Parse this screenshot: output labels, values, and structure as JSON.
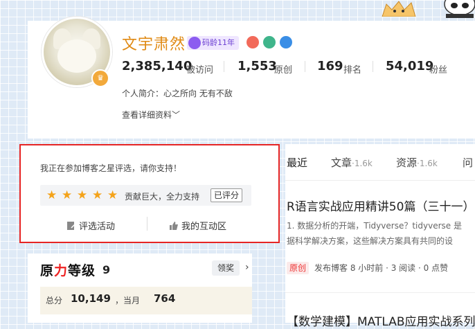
{
  "profile": {
    "username": "文宇肃然",
    "code_age": "码龄11年",
    "stats": [
      {
        "value": "2,385,140",
        "label": "被访问"
      },
      {
        "value": "1,553",
        "label": "原创"
      },
      {
        "value": "169",
        "label": "排名"
      },
      {
        "value": "54,019",
        "label": "粉丝"
      }
    ],
    "intro": "个人简介：心之所向 无有不敌",
    "detail_link": "查看详细资料"
  },
  "vote": {
    "prompt": "我正在参加博客之星评选，请你支持！",
    "rating_text": "贡献巨大，全力支持",
    "rated_label": "已评分",
    "stars": 5,
    "action_1": "评选活动",
    "action_2": "我的互动区"
  },
  "level": {
    "title_a": "原",
    "title_b": "力",
    "title_c": "等级",
    "number": "9",
    "claim_button": "领奖",
    "total_label": "总分",
    "total_value": "10,149",
    "month_label": "当月",
    "month_value": "764"
  },
  "tabs": [
    {
      "label": "最近",
      "count": ""
    },
    {
      "label": "文章",
      "count": "·1.6k"
    },
    {
      "label": "资源",
      "count": "·1.6k"
    },
    {
      "label": "问",
      "count": ""
    }
  ],
  "articles": [
    {
      "title": "R语言实战应用精讲50篇（三十一）",
      "desc_1": "1. 数据分析的开端，Tidyverse？tidyverse 是",
      "desc_2": "据科学解决方案，这些解决方案具有共同的设",
      "tag": "原创",
      "meta": "发布博客 8 小时前 · 3 阅读 · 0 点赞"
    },
    {
      "title": "【数学建模】MATLAB应用实战系列"
    }
  ],
  "colors": {
    "username": "#e08a14",
    "highlight_border": "#e62424",
    "star": "#f4a31a",
    "original_tag": "#e33"
  }
}
